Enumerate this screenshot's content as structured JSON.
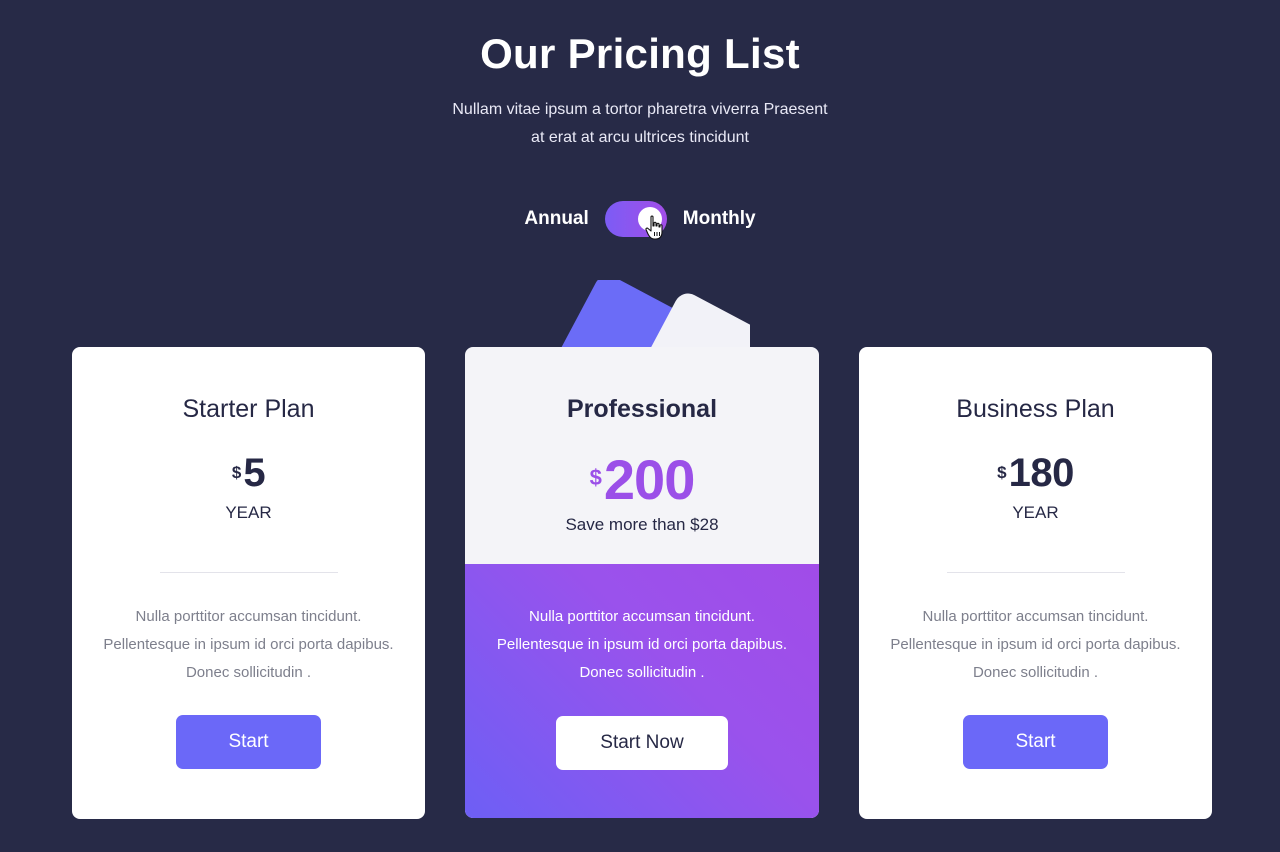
{
  "header": {
    "title": "Our Pricing List",
    "subtitle_line1": "Nullam vitae ipsum a tortor pharetra viverra Praesent",
    "subtitle_line2": "at erat at arcu ultrices tincidunt"
  },
  "billing_toggle": {
    "left_label": "Annual",
    "right_label": "Monthly",
    "state": "monthly"
  },
  "colors": {
    "background": "#272a47",
    "accent": "#6b68f8",
    "highlight": "#9b4fe8"
  },
  "plans": [
    {
      "name": "Starter Plan",
      "currency": "$",
      "price": "5",
      "period": "YEAR",
      "description": "Nulla porttitor accumsan tincidunt. Pellentesque in ipsum id orci porta dapibus. Donec sollicitudin .",
      "button_label": "Start"
    },
    {
      "name": "Professional",
      "currency": "$",
      "price": "200",
      "note": "Save more than $28",
      "description": "Nulla porttitor accumsan tincidunt. Pellentesque in ipsum id orci porta dapibus. Donec sollicitudin .",
      "button_label": "Start Now",
      "featured": true
    },
    {
      "name": "Business Plan",
      "currency": "$",
      "price": "180",
      "period": "YEAR",
      "description": "Nulla porttitor accumsan tincidunt. Pellentesque in ipsum id orci porta dapibus. Donec sollicitudin .",
      "button_label": "Start"
    }
  ]
}
